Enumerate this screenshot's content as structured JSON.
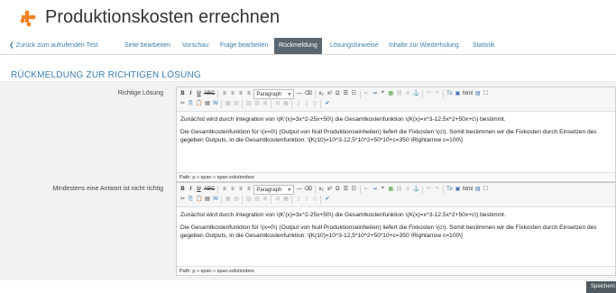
{
  "header": {
    "title": "Produktionskosten errechnen",
    "icon": "puzzle-icon",
    "accent": "#f5821f"
  },
  "tabs": [
    {
      "label": "Zurück zum aufrufenden Test",
      "icon": "chevron-left-icon"
    },
    {
      "label": "Seite bearbeiten"
    },
    {
      "label": "Vorschau"
    },
    {
      "label": "Frage bearbeiten"
    },
    {
      "label": "Rückmeldung",
      "active": true
    },
    {
      "label": "Lösungshinweise"
    },
    {
      "label": "Inhalte zur Wiederholung"
    },
    {
      "label": "Statistik"
    }
  ],
  "section": {
    "heading": "RÜCKMELDUNG ZUR RICHTIGEN LÖSUNG"
  },
  "toolbar": {
    "format_value": "Paragraph",
    "format_options": [
      "Paragraph"
    ],
    "accent": "#3a6fb0"
  },
  "fields": [
    {
      "label": "Richtige Lösung",
      "paragraphs": [
        "Zunächst wird durch Integration von \\(K'(x)=3x^2-25x+50\\) die Gesamtkostenfunktion \\(K(x)=x^3-12.5x^2+50x+c\\) bestimmt.",
        "Die Gesamtkostenfunktion für \\(x=0\\) (Output von Null Produktionseinheiten) liefert die Fixkosten \\(c\\). Somit bestimmen wir die Fixkosten durch Einsetzen des gegeben Outputs, in die Gesamtkostenfunktion: \\[K(10)=10^3-12,5*10^2+50*10+c=350 \\Rightarrow c=100\\]"
      ],
      "path": "Path: p » span » span.solutionbox"
    },
    {
      "label": "Mindestens eine Antwort ist nicht richtig",
      "paragraphs": [
        "Zunächst wird durch Integration von \\(K'(x)=3x^2-25x+50\\) die Gesamtkostenfunktion \\(K(x)=x^3-12.5x^2+50x+c\\) bestimmt.",
        "Die Gesamtkostenfunktion für \\(x=0\\) (Output von Null Produktionseinheiten) liefert die Fixkosten \\(c\\). Somit bestimmen wir die Fixkosten durch Einsetzen des gegeben Outputs, in die Gesamtkostenfunktion: \\[K(10)=10^3-12,5*10^2+50*10+c=350 \\Rightarrow c=100\\]"
      ],
      "path": "Path: p » span » span.solutionbox"
    }
  ],
  "save": {
    "label": "Speichern"
  }
}
